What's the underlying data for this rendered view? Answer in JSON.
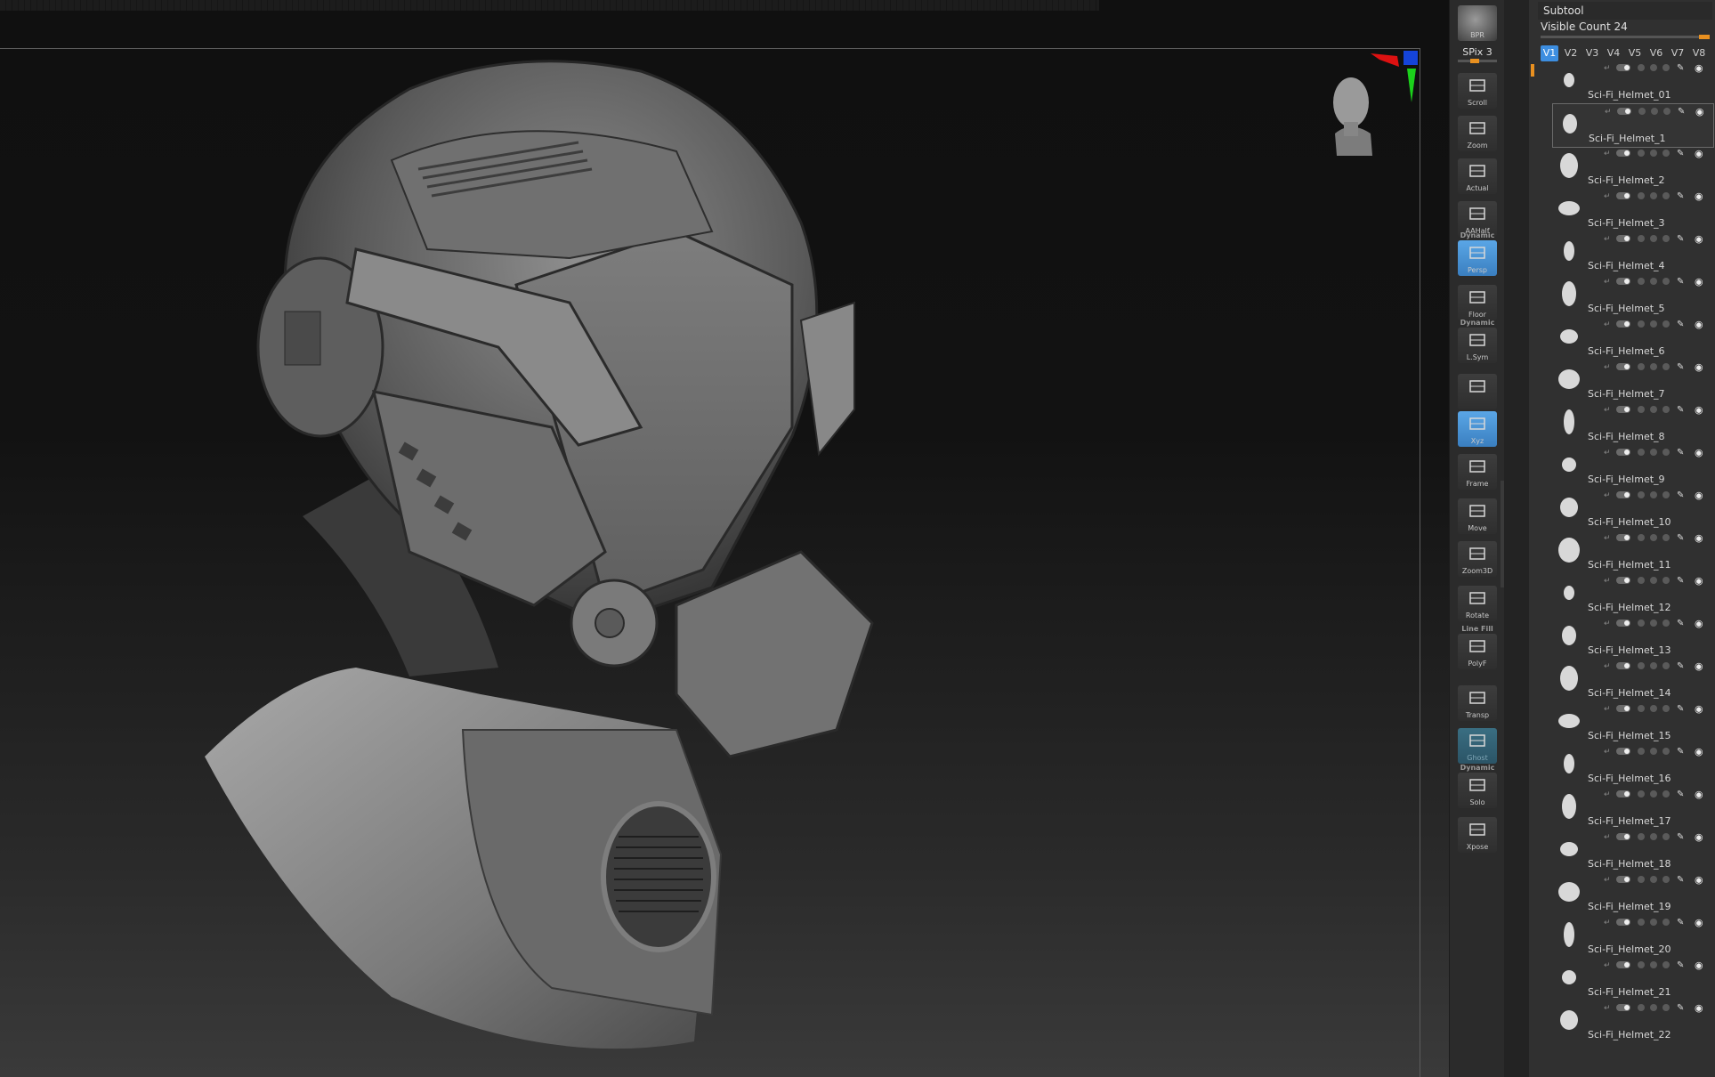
{
  "shelf": {
    "bpr": "BPR",
    "spix": "SPix 3",
    "buttons": [
      {
        "label": "Scroll"
      },
      {
        "label": "Zoom"
      },
      {
        "label": "Actual"
      },
      {
        "label": "AAHalf"
      },
      {
        "label": "Persp",
        "head": "Dynamic",
        "active": true
      },
      {
        "label": "Floor"
      },
      {
        "label": "L.Sym",
        "head": "Dynamic"
      },
      {
        "label": ""
      },
      {
        "label": "Xyz",
        "active": true
      },
      {
        "label": "Frame"
      },
      {
        "label": "Move"
      },
      {
        "label": "Zoom3D"
      },
      {
        "label": "Rotate"
      },
      {
        "label": "PolyF",
        "head": "Line Fill"
      },
      {
        "label": "Transp"
      },
      {
        "label": "Ghost"
      },
      {
        "label": "Solo",
        "head": "Dynamic"
      },
      {
        "label": "Xpose"
      }
    ]
  },
  "subtool": {
    "title": "Subtool",
    "visible_count": "Visible Count 24",
    "tabs": [
      "V1",
      "V2",
      "V3",
      "V4",
      "V5",
      "V6",
      "V7",
      "V8"
    ],
    "active_tab": "V1",
    "items": [
      "Sci-Fi_Helmet_01",
      "Sci-Fi_Helmet_1",
      "Sci-Fi_Helmet_2",
      "Sci-Fi_Helmet_3",
      "Sci-Fi_Helmet_4",
      "Sci-Fi_Helmet_5",
      "Sci-Fi_Helmet_6",
      "Sci-Fi_Helmet_7",
      "Sci-Fi_Helmet_8",
      "Sci-Fi_Helmet_9",
      "Sci-Fi_Helmet_10",
      "Sci-Fi_Helmet_11",
      "Sci-Fi_Helmet_12",
      "Sci-Fi_Helmet_13",
      "Sci-Fi_Helmet_14",
      "Sci-Fi_Helmet_15",
      "Sci-Fi_Helmet_16",
      "Sci-Fi_Helmet_17",
      "Sci-Fi_Helmet_18",
      "Sci-Fi_Helmet_19",
      "Sci-Fi_Helmet_20",
      "Sci-Fi_Helmet_21",
      "Sci-Fi_Helmet_22"
    ],
    "selected_index": 1
  },
  "colors": {
    "accent": "#3d8ee0",
    "orange": "#e89020"
  }
}
